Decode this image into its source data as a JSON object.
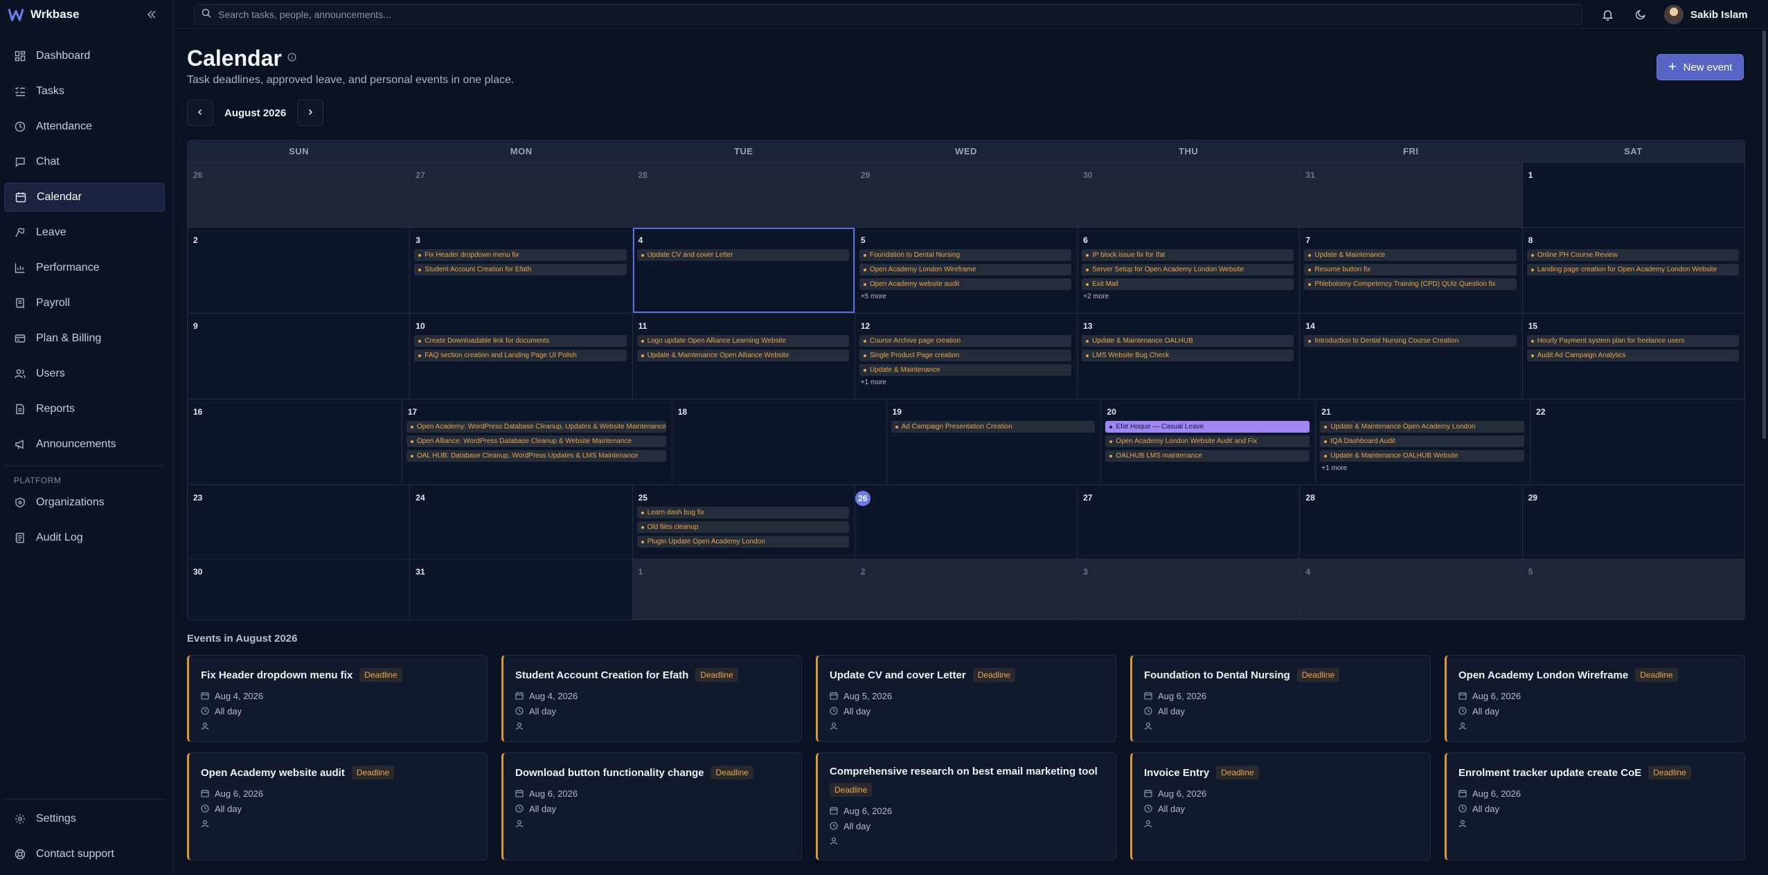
{
  "app": {
    "name": "Wrkbase"
  },
  "sidebar": {
    "items": [
      {
        "label": "Dashboard",
        "icon": "dashboard-icon"
      },
      {
        "label": "Tasks",
        "icon": "tasks-icon"
      },
      {
        "label": "Attendance",
        "icon": "clock-icon"
      },
      {
        "label": "Chat",
        "icon": "chat-icon"
      },
      {
        "label": "Calendar",
        "icon": "calendar-icon",
        "active": true
      },
      {
        "label": "Leave",
        "icon": "leave-icon"
      },
      {
        "label": "Performance",
        "icon": "chart-icon"
      },
      {
        "label": "Payroll",
        "icon": "payroll-icon"
      },
      {
        "label": "Plan & Billing",
        "icon": "card-icon"
      },
      {
        "label": "Users",
        "icon": "users-icon"
      },
      {
        "label": "Reports",
        "icon": "reports-icon"
      },
      {
        "label": "Announcements",
        "icon": "megaphone-icon"
      }
    ],
    "platform_label": "PLATFORM",
    "platform_items": [
      {
        "label": "Organizations",
        "icon": "shield-icon"
      },
      {
        "label": "Audit Log",
        "icon": "log-icon"
      }
    ],
    "bottom_items": [
      {
        "label": "Settings",
        "icon": "gear-icon"
      },
      {
        "label": "Contact support",
        "icon": "support-icon"
      }
    ]
  },
  "topbar": {
    "search_placeholder": "Search tasks, people, announcements...",
    "user_name": "Sakib Islam"
  },
  "page": {
    "title": "Calendar",
    "subtitle": "Task deadlines, approved leave, and personal events in one place.",
    "new_event_label": "New event",
    "month_label": "August 2026"
  },
  "calendar": {
    "weekdays": [
      "SUN",
      "MON",
      "TUE",
      "WED",
      "THU",
      "FRI",
      "SAT"
    ],
    "weeks": [
      [
        {
          "d": "26",
          "out": true
        },
        {
          "d": "27",
          "out": true
        },
        {
          "d": "28",
          "out": true
        },
        {
          "d": "29",
          "out": true
        },
        {
          "d": "30",
          "out": true
        },
        {
          "d": "31",
          "out": true
        },
        {
          "d": "1"
        }
      ],
      [
        {
          "d": "2"
        },
        {
          "d": "3",
          "events": [
            "Fix Header dropdown menu fix",
            "Student Account Creation for Efath"
          ]
        },
        {
          "d": "4",
          "selected": true,
          "events": [
            "Update CV and cover Letter"
          ]
        },
        {
          "d": "5",
          "events": [
            "Foundation to Dental Nursing",
            "Open Academy London Wireframe",
            "Open Academy website audit"
          ],
          "more": "+5 more"
        },
        {
          "d": "6",
          "events": [
            "IP block issue fix for Ifat",
            "Server Setup for Open Academy London Website",
            "Exit Mail"
          ],
          "more": "+2 more"
        },
        {
          "d": "7",
          "events": [
            "Update & Maintenance",
            "Resume button fix",
            "Phlebotomy Competency Training (CPD) QUiz Question fix"
          ]
        },
        {
          "d": "8",
          "events": [
            "Online PH Course Review",
            "Landing page creation for Open Academy London Website"
          ]
        }
      ],
      [
        {
          "d": "9"
        },
        {
          "d": "10",
          "events": [
            "Create Downloadable link for documents",
            "FAQ section creation and Landing Page UI Polish"
          ]
        },
        {
          "d": "11",
          "events": [
            "Logo update Open Alliance Learning Website",
            "Update & Maintenance Open Alliance Website"
          ]
        },
        {
          "d": "12",
          "events": [
            "Course Archive page creation",
            "Single Product Page creation",
            "Update & Maintenance"
          ],
          "more": "+1 more"
        },
        {
          "d": "13",
          "events": [
            "Update & Maintenance OALHUB",
            "LMS Website Bug Check"
          ]
        },
        {
          "d": "14",
          "events": [
            "Introduction to Dental Nursing Course Creation"
          ]
        },
        {
          "d": "15",
          "events": [
            "Hourly Payment system plan for freelance users",
            "Audit Ad Campaign Analytics"
          ]
        }
      ],
      [
        {
          "d": "16"
        },
        {
          "d": "17",
          "events": [
            "Open Academy: WordPress Database Cleanup, Updates & Website Maintenance",
            "Open Alliance: WordPress Database Cleanup & Website Maintenance",
            "OAL HUB: Database Cleanup, WordPress Updates & LMS Maintenance"
          ]
        },
        {
          "d": "18"
        },
        {
          "d": "19",
          "events": [
            "Ad Campaign Presentation Creation"
          ]
        },
        {
          "d": "20",
          "leave": "Efat Hoque — Casual Leave",
          "events": [
            "Open Academy London Website Audit and Fix",
            "OALHUB LMS maintenance"
          ]
        },
        {
          "d": "21",
          "events": [
            "Update & Maintenance Open Academy London",
            "IQA Dashboard Audit",
            "Update & Maintenance OALHUB Website"
          ],
          "more": "+1 more"
        },
        {
          "d": "22"
        }
      ],
      [
        {
          "d": "23"
        },
        {
          "d": "24"
        },
        {
          "d": "25",
          "events": [
            "Learn dash bug fix",
            "Old files cleanup",
            "Plugin Update Open Academy London"
          ]
        },
        {
          "d": "26",
          "today": true
        },
        {
          "d": "27"
        },
        {
          "d": "28"
        },
        {
          "d": "29"
        }
      ],
      [
        {
          "d": "30"
        },
        {
          "d": "31"
        },
        {
          "d": "1",
          "out": true
        },
        {
          "d": "2",
          "out": true
        },
        {
          "d": "3",
          "out": true
        },
        {
          "d": "4",
          "out": true
        },
        {
          "d": "5",
          "out": true
        }
      ]
    ]
  },
  "events_section": {
    "title": "Events in August 2026",
    "badge": "Deadline",
    "time": "All day",
    "cards": [
      {
        "title": "Fix Header dropdown menu fix",
        "date": "Aug 4, 2026"
      },
      {
        "title": "Student Account Creation for Efath",
        "date": "Aug 4, 2026"
      },
      {
        "title": "Update CV and cover Letter",
        "date": "Aug 5, 2026"
      },
      {
        "title": "Foundation to Dental Nursing",
        "date": "Aug 6, 2026"
      },
      {
        "title": "Open Academy London Wireframe",
        "date": "Aug 6, 2026"
      },
      {
        "title": "Open Academy website audit",
        "date": "Aug 6, 2026"
      },
      {
        "title": "Download button functionality change",
        "date": "Aug 6, 2026"
      },
      {
        "title": "Comprehensive research on best email marketing tool",
        "date": "Aug 6, 2026"
      },
      {
        "title": "Invoice Entry",
        "date": "Aug 6, 2026"
      },
      {
        "title": "Enrolment tracker update create CoE",
        "date": "Aug 6, 2026"
      }
    ]
  },
  "colors": {
    "accent": "#5865c4",
    "deadline": "#e8a54a",
    "leave": "#9f86f2",
    "today": "#6e7be6"
  }
}
